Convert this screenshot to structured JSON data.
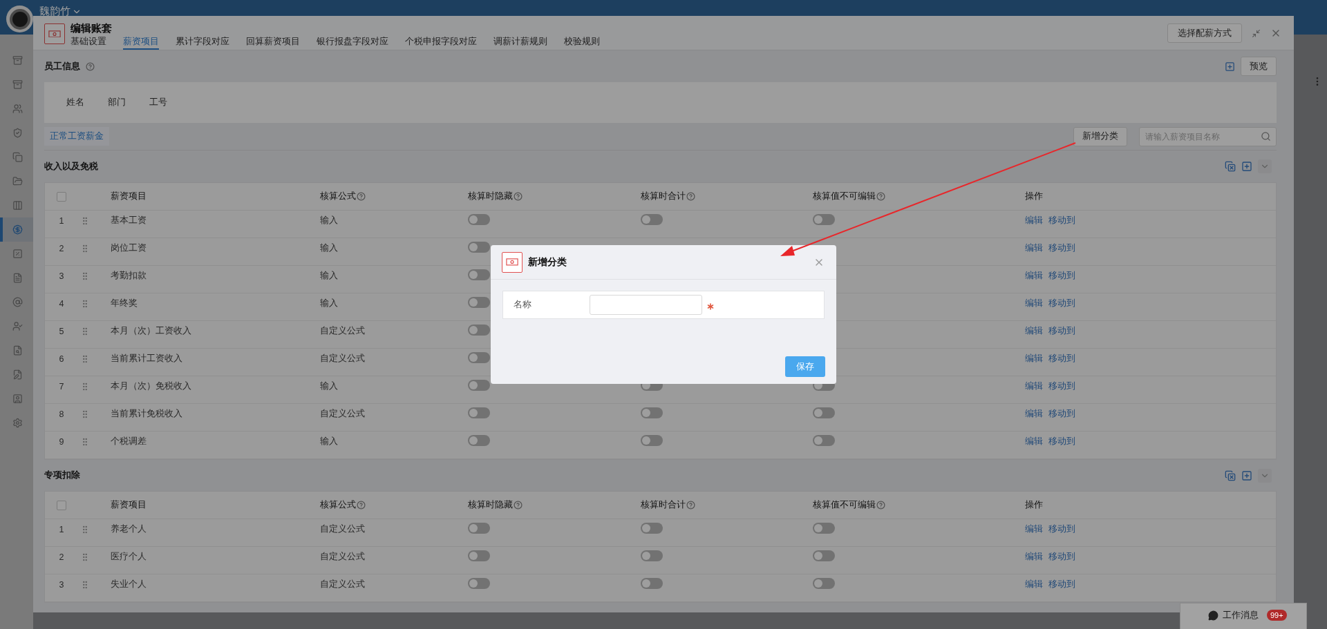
{
  "top_bar": {
    "user_name": "魏韵竹"
  },
  "sidebar": {
    "items": [
      {
        "selected": false
      },
      {
        "selected": false
      },
      {
        "selected": false
      },
      {
        "selected": false
      },
      {
        "selected": false
      },
      {
        "selected": false
      },
      {
        "selected": false
      },
      {
        "selected": true
      },
      {
        "selected": false
      },
      {
        "selected": false
      },
      {
        "selected": false
      },
      {
        "selected": false
      },
      {
        "selected": false
      },
      {
        "selected": false
      },
      {
        "selected": false
      },
      {
        "selected": false
      }
    ]
  },
  "dialog": {
    "title": "编辑账套",
    "tabs": [
      {
        "label": "基础设置",
        "selected": false
      },
      {
        "label": "薪资项目",
        "selected": true
      },
      {
        "label": "累计字段对应",
        "selected": false
      },
      {
        "label": "回算薪资项目",
        "selected": false
      },
      {
        "label": "银行报盘字段对应",
        "selected": false
      },
      {
        "label": "个税申报字段对应",
        "selected": false
      },
      {
        "label": "调薪计薪规则",
        "selected": false
      },
      {
        "label": "校验规则",
        "selected": false
      }
    ],
    "config_button": "选择配薪方式",
    "employee_info": {
      "title": "员工信息",
      "preview_button": "预览",
      "fields": [
        "姓名",
        "部门",
        "工号"
      ]
    },
    "category_tabs": [
      {
        "label": "正常工资薪金",
        "selected": true
      }
    ],
    "add_category_button": "新增分类",
    "search": {
      "placeholder": "请输入薪资项目名称"
    },
    "sections": [
      {
        "title": "收入以及免税",
        "select_all_checked": false,
        "columns": [
          {
            "label": "薪资项目",
            "help": false
          },
          {
            "label": "核算公式",
            "help": true
          },
          {
            "label": "核算时隐藏",
            "help": true
          },
          {
            "label": "核算时合计",
            "help": true
          },
          {
            "label": "核算值不可编辑",
            "help": true
          },
          {
            "label": "操作",
            "help": false
          }
        ],
        "rows": [
          {
            "index": "1",
            "name": "基本工资",
            "formula": "输入",
            "hidden": false,
            "sum": false,
            "locked": false,
            "actions": [
              "编辑",
              "移动到"
            ]
          },
          {
            "index": "2",
            "name": "岗位工资",
            "formula": "输入",
            "hidden": false,
            "actions": [
              "编辑",
              "移动到"
            ]
          },
          {
            "index": "3",
            "name": "考勤扣款",
            "formula": "输入",
            "hidden": false,
            "actions": [
              "编辑",
              "移动到"
            ]
          },
          {
            "index": "4",
            "name": "年终奖",
            "formula": "输入",
            "hidden": false,
            "actions": [
              "编辑",
              "移动到"
            ]
          },
          {
            "index": "5",
            "name": "本月（次）工资收入",
            "formula": "自定义公式",
            "hidden": false,
            "actions": [
              "编辑",
              "移动到"
            ]
          },
          {
            "index": "6",
            "name": "当前累计工资收入",
            "formula": "自定义公式",
            "hidden": false,
            "actions": [
              "编辑",
              "移动到"
            ]
          },
          {
            "index": "7",
            "name": "本月（次）免税收入",
            "formula": "输入",
            "hidden": false,
            "sum": false,
            "locked": false,
            "actions": [
              "编辑",
              "移动到"
            ]
          },
          {
            "index": "8",
            "name": "当前累计免税收入",
            "formula": "自定义公式",
            "hidden": false,
            "sum": false,
            "locked": false,
            "actions": [
              "编辑",
              "移动到"
            ]
          },
          {
            "index": "9",
            "name": "个税调差",
            "formula": "输入",
            "hidden": false,
            "sum": false,
            "locked": false,
            "actions": [
              "编辑",
              "移动到"
            ]
          }
        ]
      },
      {
        "title": "专项扣除",
        "select_all_checked": false,
        "columns": [
          {
            "label": "薪资项目",
            "help": false
          },
          {
            "label": "核算公式",
            "help": true
          },
          {
            "label": "核算时隐藏",
            "help": true
          },
          {
            "label": "核算时合计",
            "help": true
          },
          {
            "label": "核算值不可编辑",
            "help": true
          },
          {
            "label": "操作",
            "help": false
          }
        ],
        "rows": [
          {
            "index": "1",
            "name": "养老个人",
            "formula": "自定义公式",
            "hidden": false,
            "sum": false,
            "locked": false,
            "actions": [
              "编辑",
              "移动到"
            ]
          },
          {
            "index": "2",
            "name": "医疗个人",
            "formula": "自定义公式",
            "hidden": false,
            "sum": false,
            "locked": false,
            "actions": [
              "编辑",
              "移动到"
            ]
          },
          {
            "index": "3",
            "name": "失业个人",
            "formula": "自定义公式",
            "hidden": false,
            "sum": false,
            "locked": false,
            "actions": [
              "编辑",
              "移动到"
            ]
          }
        ]
      }
    ]
  },
  "modal": {
    "title": "新增分类",
    "fields": [
      {
        "label": "名称",
        "required": true
      }
    ],
    "save_button": "保存"
  },
  "message_panel": {
    "label": "工作消息",
    "badge": "99+"
  }
}
